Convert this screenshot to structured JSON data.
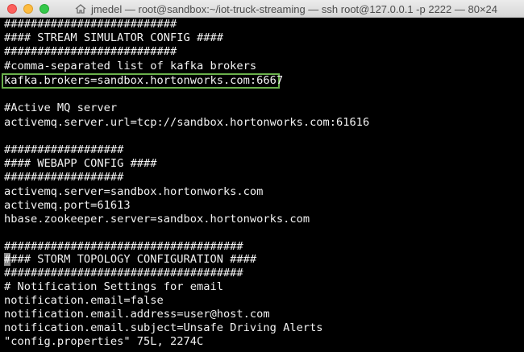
{
  "window": {
    "title": "jmedel — root@sandbox:~/iot-truck-streaming — ssh root@127.0.0.1 -p 2222 — 80×24"
  },
  "terminal": {
    "lines": [
      "##########################",
      "#### STREAM SIMULATOR CONFIG ####",
      "##########################",
      "#comma-separated list of kafka brokers",
      "kafka.brokers=sandbox.hortonworks.com:6667",
      "",
      "#Active MQ server",
      "activemq.server.url=tcp://sandbox.hortonworks.com:61616",
      "",
      "##################",
      "#### WEBAPP CONFIG ####",
      "##################",
      "activemq.server=sandbox.hortonworks.com",
      "activemq.port=61613",
      "hbase.zookeeper.server=sandbox.hortonworks.com",
      "",
      "####################################",
      "#### STORM TOPOLOGY CONFIGURATION ####",
      "####################################",
      "# Notification Settings for email",
      "notification.email=false",
      "notification.email.address=user@host.com",
      "notification.email.subject=Unsafe Driving Alerts",
      "\"config.properties\" 75L, 2274C"
    ]
  },
  "colors": {
    "background": "#000000",
    "text": "#f2f2f2",
    "highlight": "#6ab04c"
  },
  "icons": {
    "title_icon": "home-icon"
  }
}
